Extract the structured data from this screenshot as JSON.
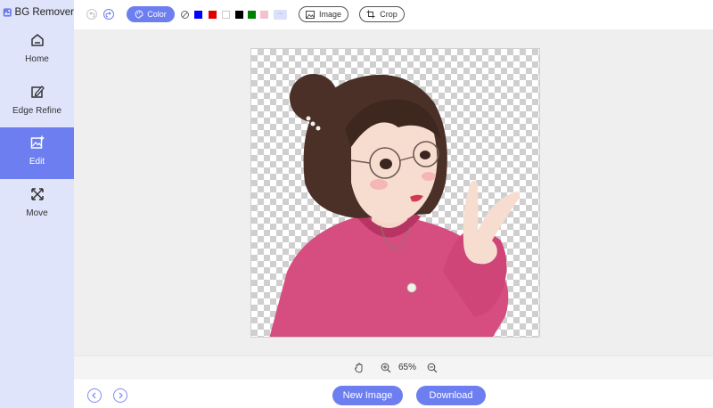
{
  "app": {
    "title": "BG Remover"
  },
  "sidebar": {
    "items": [
      {
        "label": "Home",
        "icon": "home-icon"
      },
      {
        "label": "Edge Refine",
        "icon": "edge-refine-icon"
      },
      {
        "label": "Edit",
        "icon": "edit-image-icon",
        "active": true
      },
      {
        "label": "Move",
        "icon": "move-icon"
      }
    ]
  },
  "toolbar": {
    "color_label": "Color",
    "image_label": "Image",
    "crop_label": "Crop",
    "swatches": [
      "#0000ff",
      "#e00000",
      "#ffffff",
      "#000000",
      "#008000",
      "#f4c2cc"
    ],
    "more_label": "···"
  },
  "zoom": {
    "level": "65%"
  },
  "footer": {
    "new_image_label": "New Image",
    "download_label": "Download"
  },
  "colors": {
    "accent": "#6c7ef0",
    "sidebar_bg": "#dfe4fb"
  }
}
